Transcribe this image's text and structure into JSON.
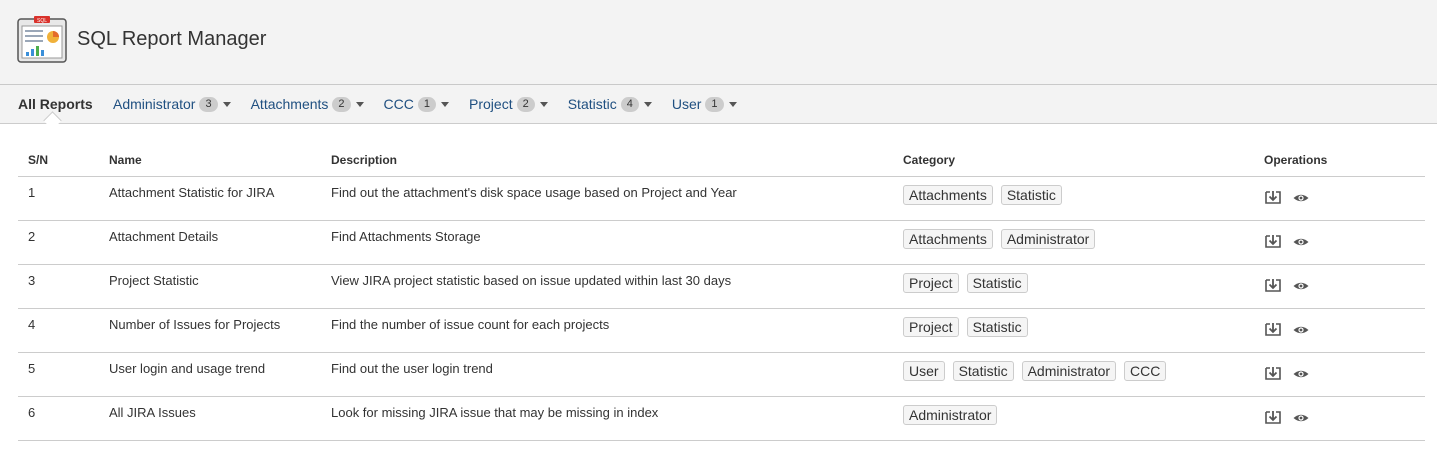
{
  "app": {
    "title": "SQL Report Manager",
    "logo_badge": "SQL"
  },
  "tabs": {
    "all_label": "All Reports",
    "items": [
      {
        "label": "Administrator",
        "count": "3"
      },
      {
        "label": "Attachments",
        "count": "2"
      },
      {
        "label": "CCC",
        "count": "1"
      },
      {
        "label": "Project",
        "count": "2"
      },
      {
        "label": "Statistic",
        "count": "4"
      },
      {
        "label": "User",
        "count": "1"
      }
    ]
  },
  "table": {
    "headers": {
      "sn": "S/N",
      "name": "Name",
      "description": "Description",
      "category": "Category",
      "operations": "Operations"
    },
    "rows": [
      {
        "sn": "1",
        "name": "Attachment Statistic for JIRA",
        "description": "Find out the attachment's disk space usage based on Project and Year",
        "categories": [
          "Attachments",
          "Statistic"
        ]
      },
      {
        "sn": "2",
        "name": "Attachment Details",
        "description": "Find Attachments Storage",
        "categories": [
          "Attachments",
          "Administrator"
        ]
      },
      {
        "sn": "3",
        "name": "Project Statistic",
        "description": "View JIRA project statistic based on issue updated within last 30 days",
        "categories": [
          "Project",
          "Statistic"
        ]
      },
      {
        "sn": "4",
        "name": "Number of Issues for Projects",
        "description": "Find the number of issue count for each projects",
        "categories": [
          "Project",
          "Statistic"
        ]
      },
      {
        "sn": "5",
        "name": "User login and usage trend",
        "description": "Find out the user login trend",
        "categories": [
          "User",
          "Statistic",
          "Administrator",
          "CCC"
        ]
      },
      {
        "sn": "6",
        "name": "All JIRA Issues",
        "description": "Look for missing JIRA issue that may be missing in index",
        "categories": [
          "Administrator"
        ]
      }
    ],
    "operation_icons": [
      "download-icon",
      "view-icon"
    ]
  },
  "colors": {
    "link": "#205081",
    "header_bg": "#f3f3f3",
    "border": "#cccccc",
    "badge": "#cccccc"
  }
}
